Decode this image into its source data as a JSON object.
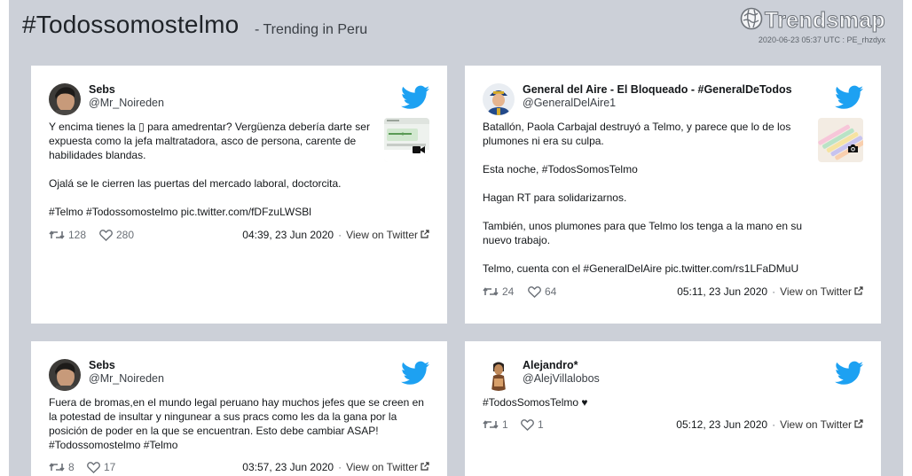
{
  "header": {
    "title": "#Todossomostelmo",
    "subtitle": "- Trending in Peru",
    "logo_text": "Trendsmap",
    "timestamp": "2020-06-23 05:37 UTC : PE_rhzdyx"
  },
  "colors": {
    "page_bg": "#ccd0d8",
    "card_bg": "#ffffff",
    "twitter_blue": "#1da1f2"
  },
  "tweets": [
    {
      "name": "Sebs",
      "handle": "@Mr_Noireden",
      "text": "Y encima tienes la ▯ para amedrentar? Vergüenza debería darte ser expuesta como la jefa maltratadora, asco de persona, carente de habilidades blandas.\n\nOjalá se le cierren las puertas del mercado laboral, doctorcita.\n\n#Telmo #Todossomostelmo pic.twitter.com/fDFzuLWSBl",
      "retweets": "128",
      "likes": "280",
      "date": "04:39, 23 Jun 2020",
      "dot": "·",
      "view_label": "View on Twitter",
      "media": "video-icon"
    },
    {
      "name": "General del Aire - El Bloqueado - #GeneralDeTodos",
      "handle": "@GeneralDelAire1",
      "text": "Batallón, Paola Carbajal destruyó a Telmo, y parece que lo de los plumones ni era su culpa.\n\nEsta noche, #TodosSomosTelmo\n\nHagan RT para solidarizarnos.\n\nTambién, unos plumones para que Telmo los tenga a la mano en su nuevo trabajo.\n\nTelmo, cuenta con el #GeneralDelAire pic.twitter.com/rs1LFaDMuU",
      "retweets": "24",
      "likes": "64",
      "date": "05:11, 23 Jun 2020",
      "dot": "·",
      "view_label": "View on Twitter",
      "media": "camera-icon"
    },
    {
      "name": "Sebs",
      "handle": "@Mr_Noireden",
      "text": "Fuera de bromas,en el mundo legal peruano hay muchos jefes que se creen en la potestad de insultar y ningunear a sus pracs como les da la gana por la posición de poder en la que se encuentran. Esto debe cambiar ASAP! #Todossomostelmo #Telmo",
      "retweets": "8",
      "likes": "17",
      "date": "03:57, 23 Jun 2020",
      "dot": "·",
      "view_label": "View on Twitter"
    },
    {
      "name": "Alejandro*",
      "handle": "@AlejVillalobos",
      "text": "#TodosSomosTelmo ♥",
      "retweets": "1",
      "likes": "1",
      "date": "05:12, 23 Jun 2020",
      "dot": "·",
      "view_label": "View on Twitter"
    }
  ]
}
